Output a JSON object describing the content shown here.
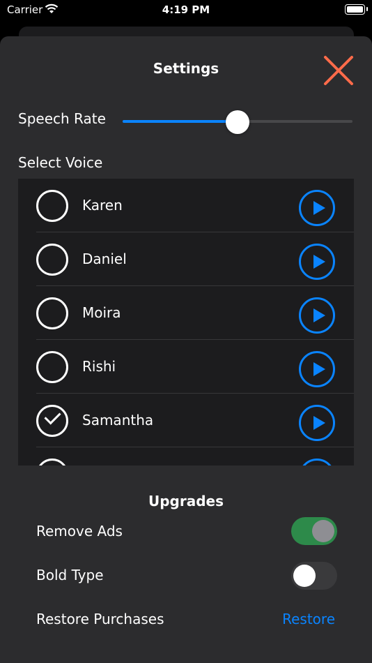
{
  "status_bar": {
    "carrier": "Carrier",
    "time": "4:19 PM"
  },
  "settings": {
    "title": "Settings",
    "speech_rate": {
      "label": "Speech Rate",
      "value": 0.5
    },
    "select_voice_label": "Select Voice",
    "voices": [
      {
        "name": "Karen",
        "selected": false
      },
      {
        "name": "Daniel",
        "selected": false
      },
      {
        "name": "Moira",
        "selected": false
      },
      {
        "name": "Rishi",
        "selected": false
      },
      {
        "name": "Samantha",
        "selected": true
      },
      {
        "name": "",
        "selected": false
      }
    ]
  },
  "upgrades": {
    "title": "Upgrades",
    "remove_ads": {
      "label": "Remove Ads",
      "on": true
    },
    "bold_type": {
      "label": "Bold Type",
      "on": false
    },
    "restore_purchases": {
      "label": "Restore Purchases",
      "button": "Restore"
    }
  },
  "colors": {
    "accent": "#0a84ff",
    "close": "#ff6b4a",
    "toggle_on": "#2d8a4a"
  }
}
